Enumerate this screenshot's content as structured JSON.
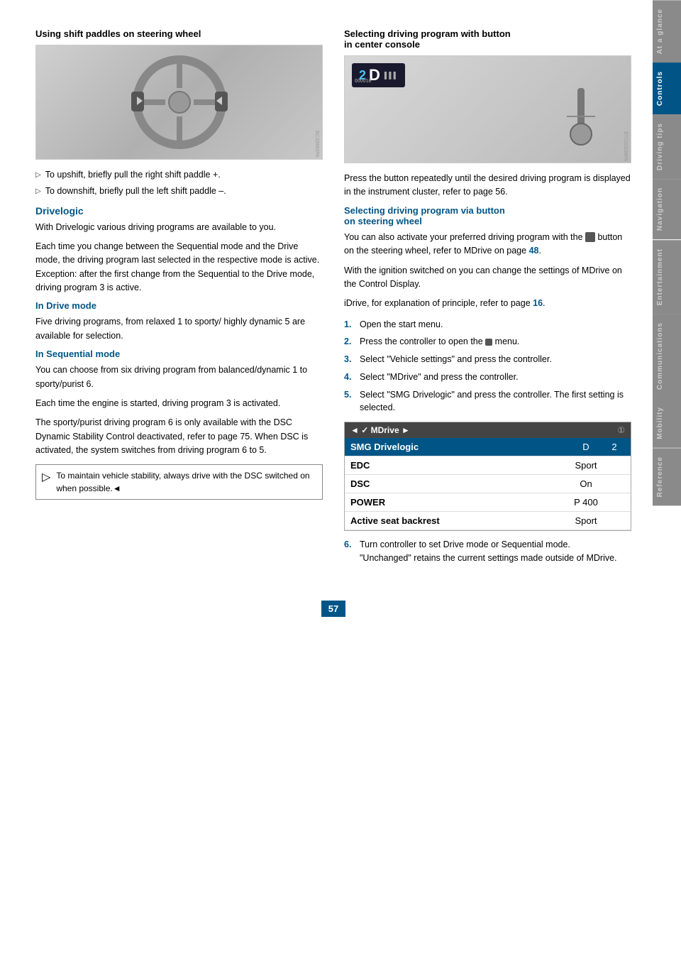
{
  "sidebar": {
    "tabs": [
      {
        "label": "At a glance",
        "active": false
      },
      {
        "label": "Controls",
        "active": true
      },
      {
        "label": "Driving tips",
        "active": false
      },
      {
        "label": "Navigation",
        "active": false
      },
      {
        "label": "Entertainment",
        "active": false
      },
      {
        "label": "Communications",
        "active": false
      },
      {
        "label": "Mobility",
        "active": false
      },
      {
        "label": "Reference",
        "active": false
      }
    ]
  },
  "left_section": {
    "heading": "Using shift paddles on steering wheel",
    "bullet1": "To upshift, briefly pull the right shift paddle +.",
    "bullet2": "To downshift, briefly pull the left shift paddle –.",
    "drivelogic_heading": "Drivelogic",
    "drivelogic_intro": "With Drivelogic various driving programs are available to you.",
    "drivelogic_p2": "Each time you change between the Sequential mode and the Drive mode, the driving program last selected in the respective mode is active. Exception: after the first change from the Sequential to the Drive mode, driving program 3 is active.",
    "in_drive_heading": "In Drive mode",
    "in_drive_text": "Five driving programs, from relaxed 1 to sporty/ highly dynamic 5 are available for selection.",
    "in_seq_heading": "In Sequential mode",
    "in_seq_text1": "You can choose from six driving program from balanced/dynamic 1 to sporty/purist 6.",
    "in_seq_text2": "Each time the engine is started, driving program 3 is activated.",
    "in_seq_text3": "The sporty/purist driving program 6 is only available with the DSC Dynamic Stability Control deactivated, refer to page 75. When DSC is activated, the system switches from driving program 6 to 5.",
    "warning_text": "To maintain vehicle stability, always drive with the DSC switched on when possible.◄"
  },
  "right_section": {
    "heading1": "Selecting driving program with button",
    "heading1_line2": "in center console",
    "press_text": "Press the button repeatedly until the desired driving program is displayed in the instrument cluster, refer to page 56.",
    "heading2": "Selecting driving program via button",
    "heading2_line2": "on steering wheel",
    "steering_text1": "You can also activate your preferred driving program with the  button on the steering wheel, refer to MDrive on page 48.",
    "steering_text2": "With the ignition switched on you can change the settings of MDrive on the Control Display.",
    "idrive_text": "iDrive, for explanation of principle, refer to page 16.",
    "steps": [
      {
        "num": "1.",
        "text": "Open the start menu."
      },
      {
        "num": "2.",
        "text": "Press the controller to open the  menu."
      },
      {
        "num": "3.",
        "text": "Select \"Vehicle settings\" and press the controller."
      },
      {
        "num": "4.",
        "text": "Select \"MDrive\" and press the controller."
      },
      {
        "num": "5.",
        "text": "Select \"SMG Drivelogic\" and press the controller. The first setting is selected."
      }
    ],
    "mdrive_table": {
      "header_left": "◄ ✓  MDrive ►",
      "header_right": "①",
      "rows": [
        {
          "col1": "SMG Drivelogic",
          "col2": "D",
          "col3": "2",
          "highlighted": true
        },
        {
          "col1": "EDC",
          "col2": "Sport",
          "col3": "",
          "highlighted": false
        },
        {
          "col1": "DSC",
          "col2": "On",
          "col3": "",
          "highlighted": false
        },
        {
          "col1": "POWER",
          "col2": "P 400",
          "col3": "",
          "highlighted": false
        },
        {
          "col1": "Active seat backrest",
          "col2": "Sport",
          "col3": "",
          "highlighted": false
        }
      ]
    },
    "step6": {
      "num": "6.",
      "text1": "Turn controller to set Drive mode or Sequential mode.",
      "text2": "\"Unchanged\" retains the current settings made outside of MDrive."
    }
  },
  "page_number": "57",
  "display_text": "2D",
  "display_id": "000016"
}
